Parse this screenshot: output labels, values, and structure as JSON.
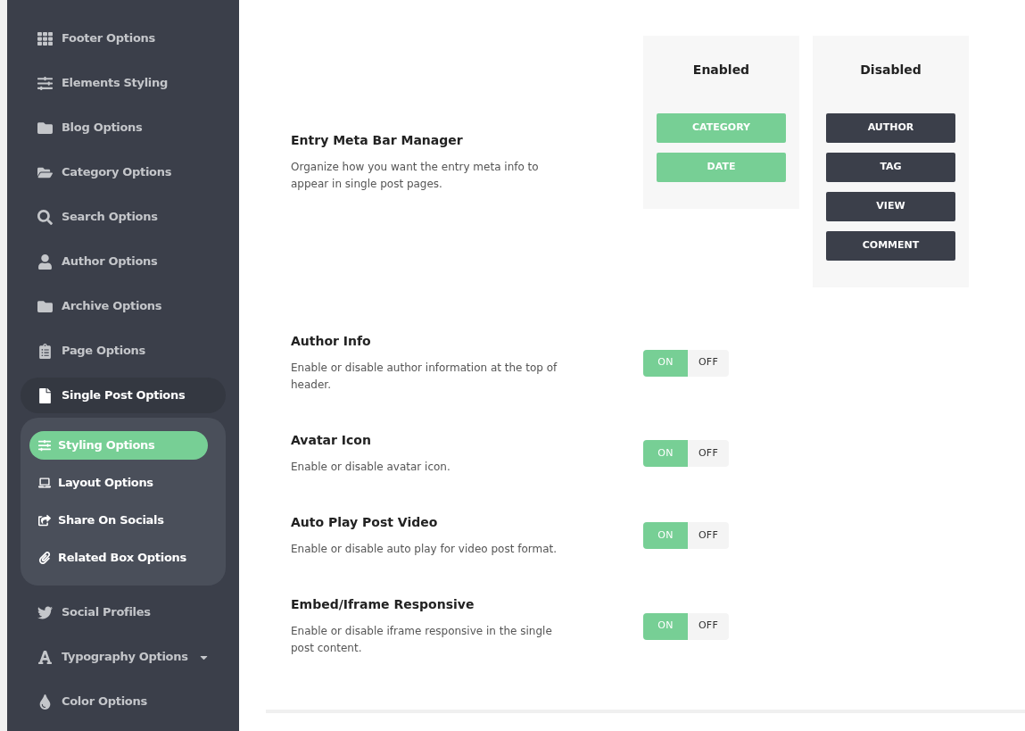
{
  "sidebar": {
    "items": [
      {
        "label": "Footer Options"
      },
      {
        "label": "Elements Styling"
      },
      {
        "label": "Blog Options"
      },
      {
        "label": "Category Options"
      },
      {
        "label": "Search Options"
      },
      {
        "label": "Author Options"
      },
      {
        "label": "Archive Options"
      },
      {
        "label": "Page Options"
      },
      {
        "label": "Single Post Options",
        "expanded": true,
        "children": [
          {
            "label": "Styling Options",
            "selected": true
          },
          {
            "label": "Layout Options",
            "selected": false
          },
          {
            "label": "Share On Socials",
            "selected": false
          },
          {
            "label": "Related Box Options",
            "selected": false
          }
        ]
      },
      {
        "label": "Social Profiles"
      },
      {
        "label": "Typography Options",
        "expanded": false
      },
      {
        "label": "Color Options"
      }
    ]
  },
  "sections": [
    {
      "kind": "sorter",
      "title": "Entry Meta Bar Manager",
      "description": "Organize how you want the entry meta info to appear in single post pages.",
      "columns": [
        {
          "title": "Enabled",
          "enabled": true,
          "items": [
            "CATEGORY",
            "DATE"
          ]
        },
        {
          "title": "Disabled",
          "enabled": false,
          "items": [
            "AUTHOR",
            "TAG",
            "VIEW",
            "COMMENT"
          ]
        }
      ]
    },
    {
      "kind": "toggle",
      "title": "Author Info",
      "description": "Enable or disable author information at the top of header.",
      "on": true,
      "on_label": "ON",
      "off_label": "OFF"
    },
    {
      "kind": "toggle",
      "title": "Avatar Icon",
      "description": "Enable or disable avatar icon.",
      "on": true,
      "on_label": "ON",
      "off_label": "OFF"
    },
    {
      "kind": "toggle",
      "title": "Auto Play Post Video",
      "description": "Enable or disable auto play for video post format.",
      "on": true,
      "on_label": "ON",
      "off_label": "OFF"
    },
    {
      "kind": "toggle",
      "title": "Embed/Iframe Responsive",
      "description": "Enable or disable iframe responsive in the single post content.",
      "on": true,
      "on_label": "ON",
      "off_label": "OFF"
    }
  ]
}
